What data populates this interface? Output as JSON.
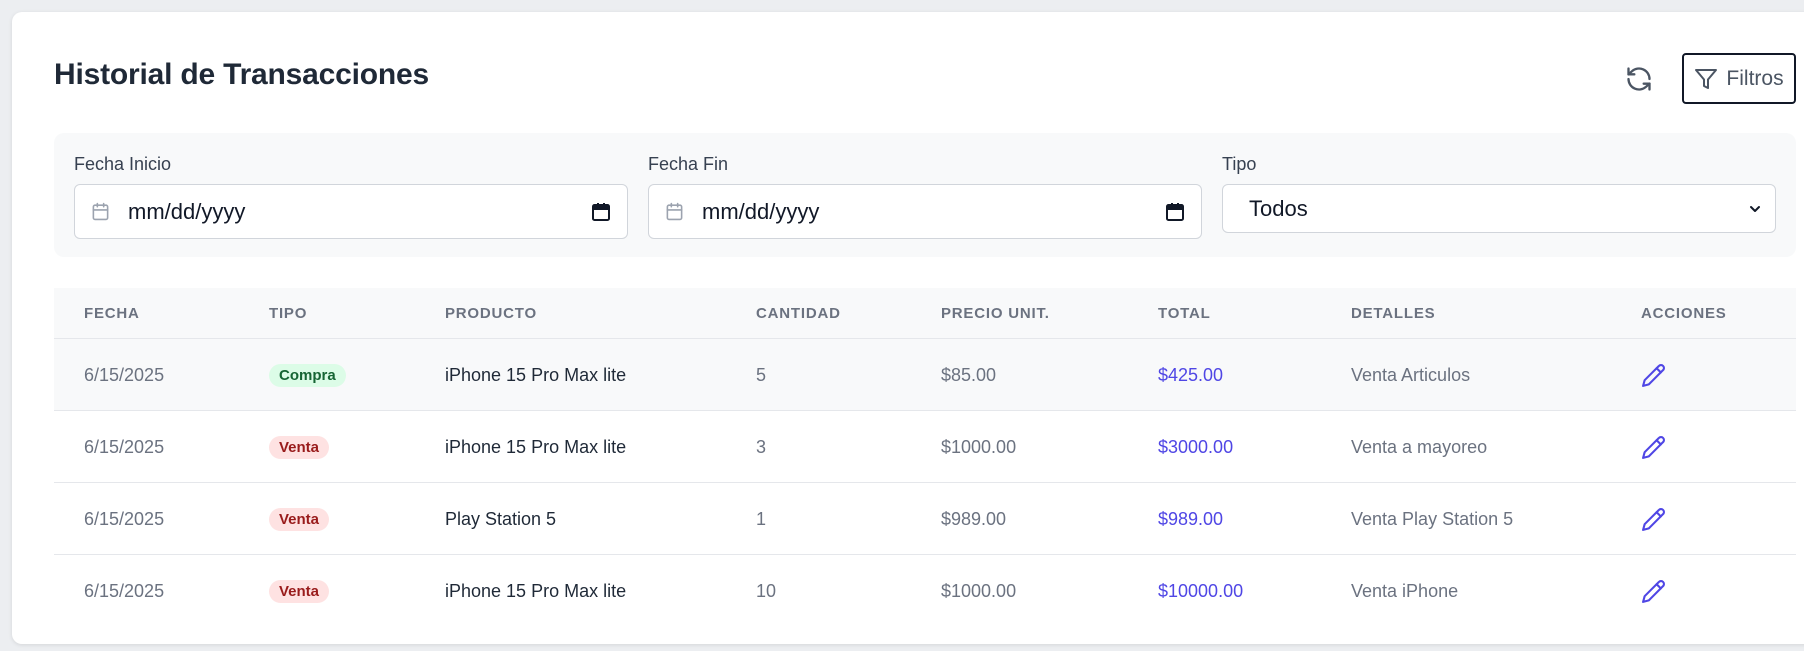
{
  "header": {
    "title": "Historial de Transacciones",
    "filters_label": "Filtros",
    "refresh_icon": "refresh-icon",
    "filter_icon": "filter-icon"
  },
  "filters": {
    "start_date": {
      "label": "Fecha Inicio",
      "value": "mm/dd/yyyy"
    },
    "end_date": {
      "label": "Fecha Fin",
      "value": "mm/dd/yyyy"
    },
    "type": {
      "label": "Tipo",
      "selected": "Todos"
    }
  },
  "table": {
    "columns": [
      "FECHA",
      "TIPO",
      "PRODUCTO",
      "CANTIDAD",
      "PRECIO UNIT.",
      "TOTAL",
      "DETALLES",
      "ACCIONES"
    ],
    "rows": [
      {
        "fecha": "6/15/2025",
        "tipo": "Compra",
        "producto": "iPhone 15 Pro Max lite",
        "cantidad": "5",
        "precio": "$85.00",
        "total": "$425.00",
        "detalles": "Venta Articulos"
      },
      {
        "fecha": "6/15/2025",
        "tipo": "Venta",
        "producto": "iPhone 15 Pro Max lite",
        "cantidad": "3",
        "precio": "$1000.00",
        "total": "$3000.00",
        "detalles": "Venta a mayoreo"
      },
      {
        "fecha": "6/15/2025",
        "tipo": "Venta",
        "producto": "Play Station 5",
        "cantidad": "1",
        "precio": "$989.00",
        "total": "$989.00",
        "detalles": "Venta Play Station 5"
      },
      {
        "fecha": "6/15/2025",
        "tipo": "Venta",
        "producto": "iPhone 15 Pro Max lite",
        "cantidad": "10",
        "precio": "$1000.00",
        "total": "$10000.00",
        "detalles": "Venta iPhone"
      }
    ]
  },
  "colors": {
    "accent": "#4f46e5",
    "compra_bg": "#dcfce7",
    "compra_text": "#166534",
    "venta_bg": "#fee2e2",
    "venta_text": "#991b1b"
  }
}
